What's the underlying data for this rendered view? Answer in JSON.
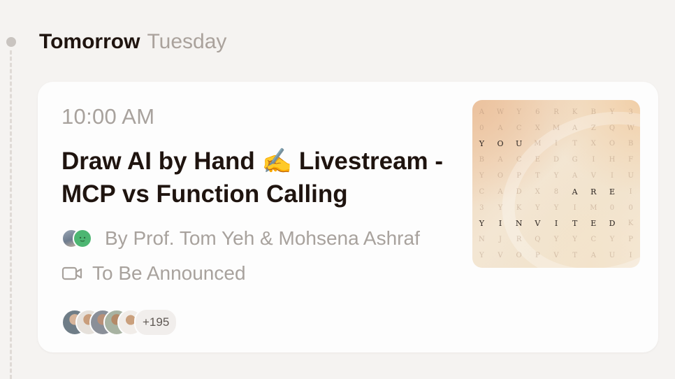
{
  "date_header": {
    "primary": "Tomorrow",
    "secondary": "Tuesday"
  },
  "event": {
    "time": "10:00 AM",
    "title": "Draw AI by Hand ✍️ Livestream - MCP vs Function Calling",
    "hosts_text": "By Prof. Tom Yeh & Mohsena Ashraf",
    "location": "To Be Announced",
    "attendee_extra": "+195",
    "icons": {
      "location": "video-camera-icon"
    }
  },
  "cover": {
    "grid": [
      [
        "A",
        "W",
        "Y",
        "6",
        "R",
        "K",
        "B",
        "Y",
        "3"
      ],
      [
        "0",
        "A",
        "C",
        "X",
        "M",
        "A",
        "Z",
        "Q",
        "W"
      ],
      [
        "Y",
        "O",
        "U",
        "M",
        "I",
        "T",
        "X",
        "O",
        "B"
      ],
      [
        "B",
        "A",
        "C",
        "E",
        "D",
        "G",
        "I",
        "H",
        "F"
      ],
      [
        "Y",
        "O",
        "P",
        "T",
        "Y",
        "A",
        "V",
        "I",
        "U"
      ],
      [
        "C",
        "A",
        "D",
        "X",
        "8",
        "A",
        "R",
        "E",
        "I"
      ],
      [
        "3",
        "Y",
        "K",
        "Y",
        "Y",
        "I",
        "M",
        "0",
        "0"
      ],
      [
        "Y",
        "I",
        "N",
        "V",
        "I",
        "T",
        "E",
        "D",
        "K"
      ],
      [
        "N",
        "J",
        "R",
        "Q",
        "Y",
        "Y",
        "C",
        "Y",
        "P"
      ],
      [
        "Y",
        "V",
        "O",
        "P",
        "V",
        "T",
        "A",
        "U",
        "I"
      ]
    ],
    "highlighted": [
      "2-0",
      "2-1",
      "2-2",
      "5-5",
      "5-6",
      "5-7",
      "7-0",
      "7-1",
      "7-2",
      "7-3",
      "7-4",
      "7-5",
      "7-6",
      "7-7"
    ]
  },
  "colors": {
    "background": "#f5f3f1",
    "card": "#fdfdfd",
    "title": "#1f140f",
    "muted": "#a8a29d"
  }
}
